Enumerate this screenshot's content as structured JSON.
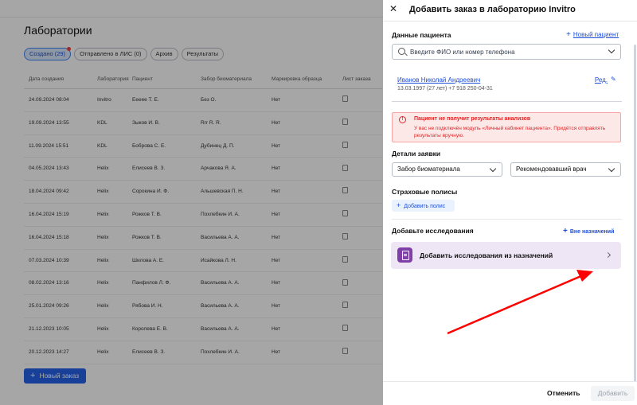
{
  "background": {
    "title": "Лаборатории",
    "filters": [
      {
        "label": "Создано (29)",
        "active": true
      },
      {
        "label": "Отправлено в ЛИС (0)",
        "active": false
      },
      {
        "label": "Архив",
        "active": false
      },
      {
        "label": "Результаты",
        "active": false
      }
    ],
    "columns": [
      "Дата создания",
      "Лаборатория",
      "Пациент",
      "Забор биоматериала",
      "Маркировка образца",
      "Лист заказа"
    ],
    "rows": [
      [
        "24.09.2024 08:04",
        "Invitro",
        "Еееее Т. Е.",
        "Без О.",
        "Нет"
      ],
      [
        "19.09.2024 13:55",
        "KDL",
        "Зыков И. В.",
        "Rrr R. R.",
        "Нет"
      ],
      [
        "11.09.2024 15:51",
        "KDL",
        "Боброва С. Е.",
        "Дубинец Д. П.",
        "Нет"
      ],
      [
        "04.05.2024 13:43",
        "Helix",
        "Елисеев В. З.",
        "Арчакова Я. А.",
        "Нет"
      ],
      [
        "18.04.2024 09:42",
        "Helix",
        "Сорокина И. Ф.",
        "Альшевская П. Н.",
        "Нет"
      ],
      [
        "16.04.2024 15:19",
        "Helix",
        "Рожков Т. В.",
        "Похлебкин И. А.",
        "Нет"
      ],
      [
        "16.04.2024 15:18",
        "Helix",
        "Рожков Т. В.",
        "Васильева А. А.",
        "Нет"
      ],
      [
        "07.03.2024 10:39",
        "Helix",
        "Шилова А. Е.",
        "Исайкова Л. Н.",
        "Нет"
      ],
      [
        "08.02.2024 13:16",
        "Helix",
        "Панфилов Л. Ф.",
        "Васильева А. А.",
        "Нет"
      ],
      [
        "25.01.2024 09:26",
        "Helix",
        "Рябова И. Н.",
        "Васильева А. А.",
        "Нет"
      ],
      [
        "21.12.2023 10:05",
        "Helix",
        "Королева Е. В.",
        "Васильева А. А.",
        "Нет"
      ],
      [
        "20.12.2023 14:27",
        "Helix",
        "Елисеев В. З.",
        "Похлебкин И. А.",
        "Нет"
      ]
    ],
    "new_order_label": "Новый заказ"
  },
  "drawer": {
    "title": "Добавить заказ в лабораторию Invitro",
    "patient_section_label": "Данные пациента",
    "new_patient_link": "Новый пациент",
    "search_placeholder": "Введите ФИО или номер телефона",
    "patient": {
      "name": "Иванов Николай Андреевич",
      "meta": "13.03.1997 (27 лет)  +7 918 250-04-31",
      "edit_label": "Ред."
    },
    "alert": {
      "title": "Пациент не получит результаты анализов",
      "text": "У вас не подключён модуль «Личный кабинет пациента». Придётся отправлять результаты вручную."
    },
    "details_label": "Детали заявки",
    "biomaterial_select": "Забор биоматериала",
    "doctor_select": "Рекомендовавший врач",
    "insurance_label": "Страховые полисы",
    "add_policy_label": "Добавить полис",
    "studies_label": "Добавьте исследования",
    "out_of_assignments_label": "Вне назначений",
    "add_from_assignments_label": "Добавить исследования из назначений",
    "cancel_label": "Отменить",
    "add_label": "Добавить"
  },
  "colors": {
    "accent": "#1d4ed8",
    "alert": "#dc2626",
    "assign_bg": "#efe6f5",
    "assign_icon": "#7e3fa6",
    "annotation_arrow": "#ff0000"
  }
}
